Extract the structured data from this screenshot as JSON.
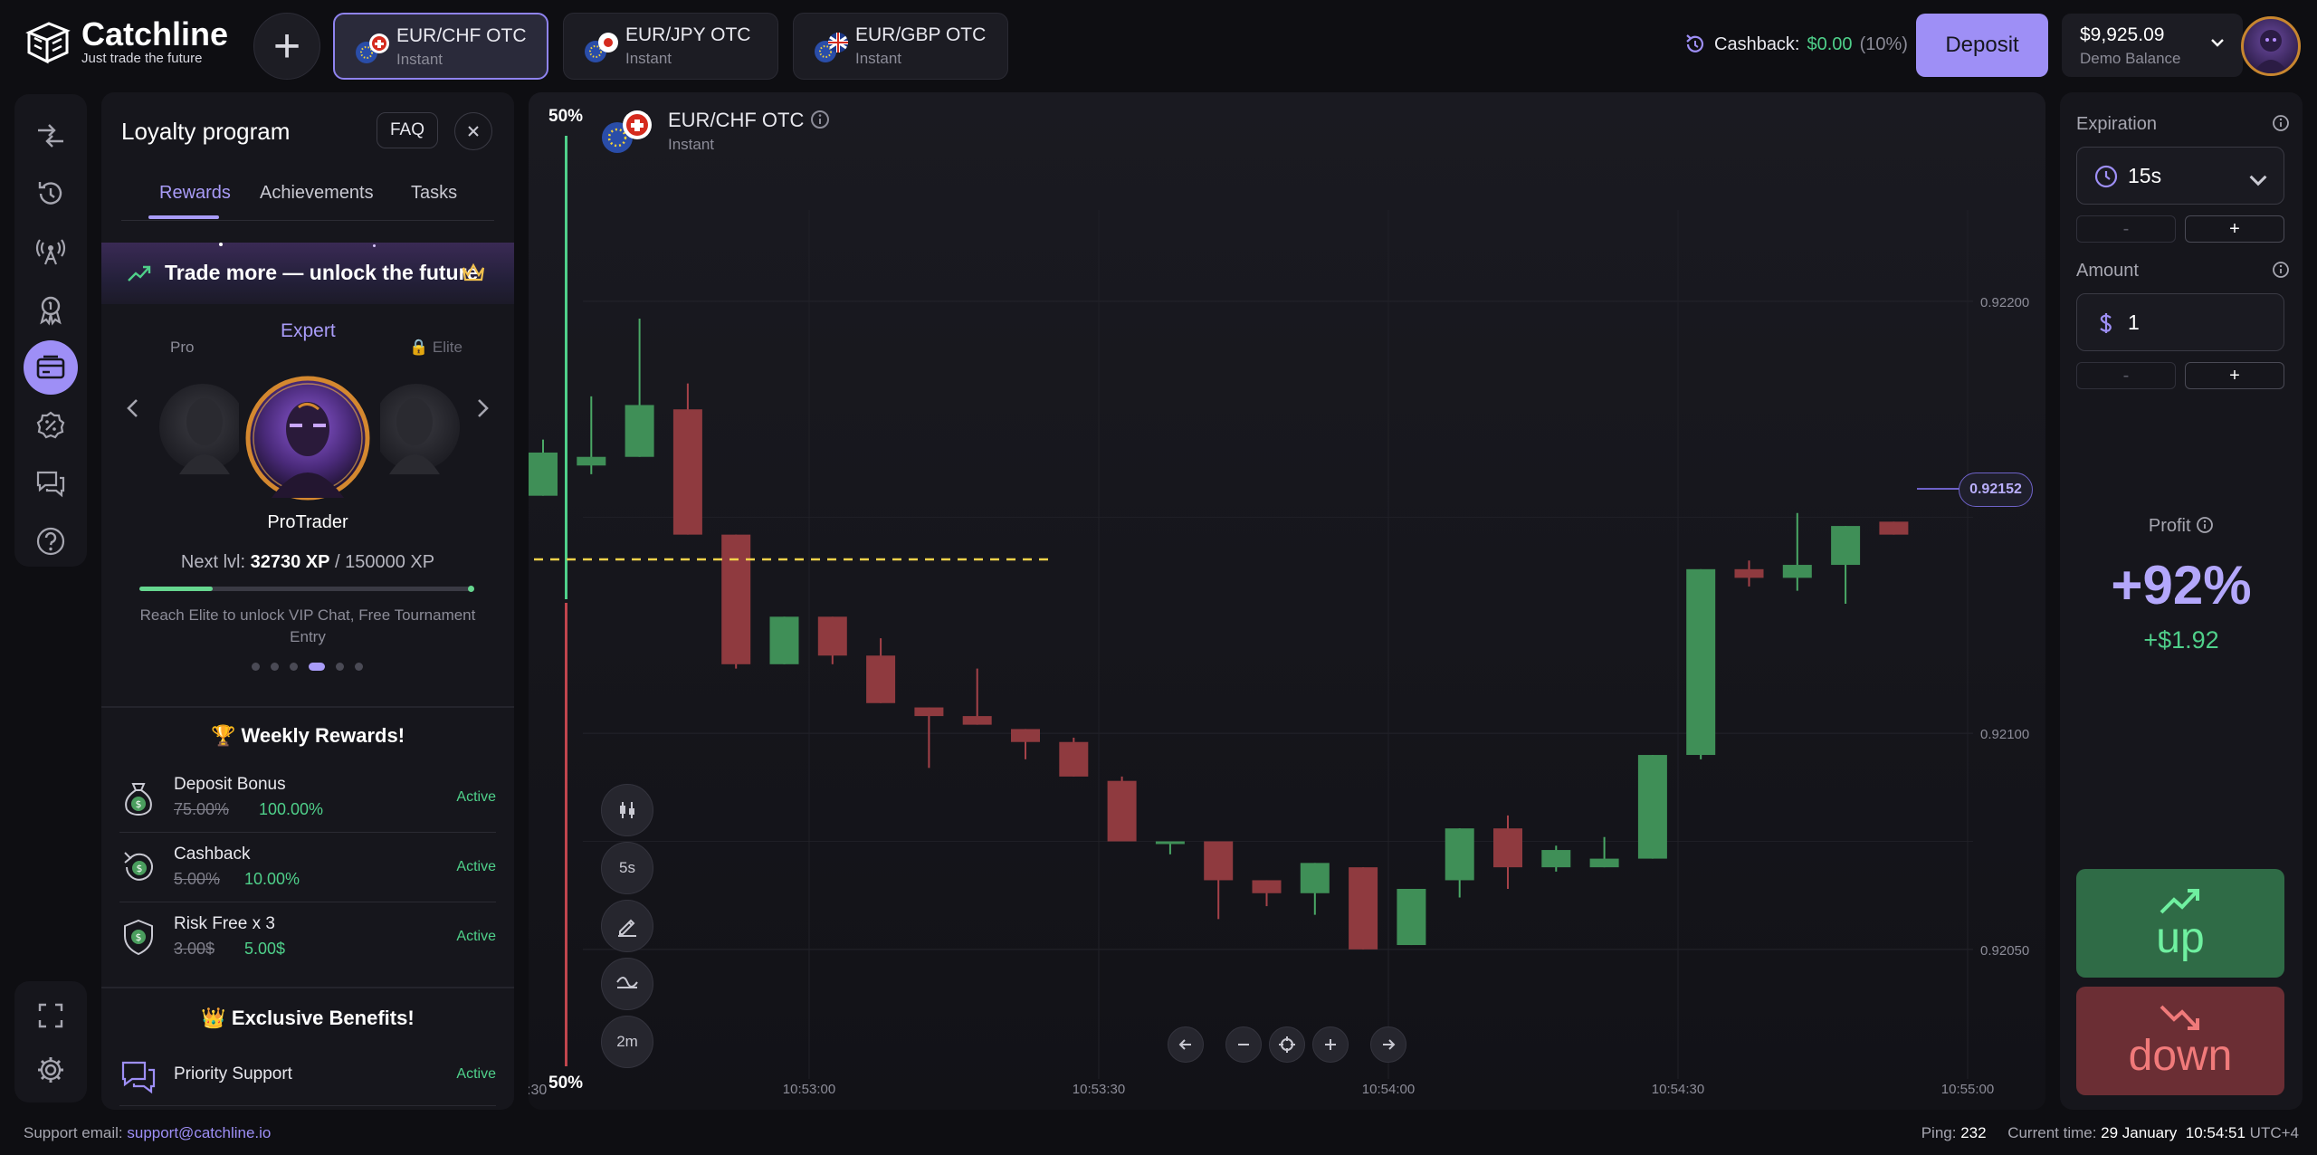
{
  "brand": {
    "name": "Catchline",
    "tagline": "Just trade the future"
  },
  "tabs": [
    {
      "pair": "EUR/CHF OTC",
      "type": "Instant",
      "active": true
    },
    {
      "pair": "EUR/JPY OTC",
      "type": "Instant",
      "active": false
    },
    {
      "pair": "EUR/GBP OTC",
      "type": "Instant",
      "active": false
    }
  ],
  "cashback": {
    "label": "Cashback:",
    "amount": "$0.00",
    "percent": "(10%)"
  },
  "deposit_label": "Deposit",
  "balance": {
    "value": "$9,925.09",
    "label": "Demo Balance"
  },
  "loyalty": {
    "title": "Loyalty program",
    "faq": "FAQ",
    "tabs": [
      "Rewards",
      "Achievements",
      "Tasks"
    ],
    "banner": "Trade more — unlock the future",
    "tiers": {
      "prev": "Pro",
      "current": "Expert",
      "next": "Elite"
    },
    "character": "ProTrader",
    "next_lvl": {
      "label": "Next lvl:",
      "current": "32730 XP",
      "sep": "/",
      "target": "150000 XP",
      "progress": 0.2182
    },
    "reach": "Reach Elite to unlock VIP Chat, Free Tournament Entry",
    "weekly_title": "Weekly Rewards!",
    "weekly": [
      {
        "name": "Deposit Bonus",
        "old": "75.00%",
        "new": "100.00%",
        "status": "Active",
        "icon": "money-bag-icon"
      },
      {
        "name": "Cashback",
        "old": "5.00%",
        "new": "10.00%",
        "status": "Active",
        "icon": "cashback-icon"
      },
      {
        "name": "Risk Free x 3",
        "old": "3.00$",
        "new": "5.00$",
        "status": "Active",
        "icon": "shield-dollar-icon"
      }
    ],
    "exclusive_title": "Exclusive Benefits!",
    "exclusive": [
      {
        "name": "Priority Support",
        "status": "Active",
        "icon": "chat-icon"
      }
    ]
  },
  "chart": {
    "asset": "EUR/CHF OTC",
    "asset_type": "Instant",
    "pct_top": "50%",
    "pct_bottom": "50%",
    "current_price": "0.92152",
    "tools": [
      "candles-icon",
      "5s",
      "pencil-icon",
      "indicator-icon",
      "2m"
    ],
    "x_edge_label": ":30"
  },
  "chart_data": {
    "type": "candlestick",
    "y_ticks": [
      "0.92200",
      "0.92100",
      "0.92050"
    ],
    "x_ticks": [
      "10:53:00",
      "10:53:30",
      "10:54:00",
      "10:54:30",
      "10:55:00"
    ],
    "candles": [
      {
        "o": 0.92155,
        "c": 0.92165,
        "h": 0.92168,
        "l": 0.92155
      },
      {
        "o": 0.92162,
        "c": 0.92164,
        "h": 0.92178,
        "l": 0.9216
      },
      {
        "o": 0.92164,
        "c": 0.92176,
        "h": 0.92196,
        "l": 0.92164
      },
      {
        "o": 0.92175,
        "c": 0.92146,
        "h": 0.92181,
        "l": 0.92146
      },
      {
        "o": 0.92146,
        "c": 0.92116,
        "h": 0.92146,
        "l": 0.92115
      },
      {
        "o": 0.92116,
        "c": 0.92127,
        "h": 0.92127,
        "l": 0.92116
      },
      {
        "o": 0.92127,
        "c": 0.92118,
        "h": 0.92127,
        "l": 0.92116
      },
      {
        "o": 0.92118,
        "c": 0.92107,
        "h": 0.92122,
        "l": 0.92107
      },
      {
        "o": 0.92106,
        "c": 0.92104,
        "h": 0.92106,
        "l": 0.92092
      },
      {
        "o": 0.92104,
        "c": 0.92102,
        "h": 0.92115,
        "l": 0.92102
      },
      {
        "o": 0.92101,
        "c": 0.92098,
        "h": 0.92101,
        "l": 0.92094
      },
      {
        "o": 0.92098,
        "c": 0.9209,
        "h": 0.92099,
        "l": 0.9209
      },
      {
        "o": 0.92089,
        "c": 0.92075,
        "h": 0.9209,
        "l": 0.92075
      },
      {
        "o": 0.92075,
        "c": 0.92075,
        "h": 0.92075,
        "l": 0.92072
      },
      {
        "o": 0.92075,
        "c": 0.92066,
        "h": 0.92075,
        "l": 0.92057
      },
      {
        "o": 0.92066,
        "c": 0.92063,
        "h": 0.92066,
        "l": 0.9206
      },
      {
        "o": 0.92063,
        "c": 0.9207,
        "h": 0.9207,
        "l": 0.92058
      },
      {
        "o": 0.92069,
        "c": 0.9205,
        "h": 0.92069,
        "l": 0.9205
      },
      {
        "o": 0.92051,
        "c": 0.92064,
        "h": 0.92064,
        "l": 0.92051
      },
      {
        "o": 0.92066,
        "c": 0.92078,
        "h": 0.92078,
        "l": 0.92062
      },
      {
        "o": 0.92078,
        "c": 0.92069,
        "h": 0.92081,
        "l": 0.92064
      },
      {
        "o": 0.92069,
        "c": 0.92073,
        "h": 0.92074,
        "l": 0.92068
      },
      {
        "o": 0.92069,
        "c": 0.92071,
        "h": 0.92076,
        "l": 0.92069
      },
      {
        "o": 0.92071,
        "c": 0.92095,
        "h": 0.92095,
        "l": 0.92071
      },
      {
        "o": 0.92095,
        "c": 0.92138,
        "h": 0.92138,
        "l": 0.92094
      },
      {
        "o": 0.92138,
        "c": 0.92136,
        "h": 0.9214,
        "l": 0.92134
      },
      {
        "o": 0.92136,
        "c": 0.92139,
        "h": 0.92151,
        "l": 0.92133
      },
      {
        "o": 0.92139,
        "c": 0.92148,
        "h": 0.92148,
        "l": 0.9213
      },
      {
        "o": 0.92149,
        "c": 0.92146,
        "h": 0.92149,
        "l": 0.92146
      }
    ],
    "ylim": [
      0.9202,
      0.9224
    ],
    "y_tick_values": [
      0.922,
      0.921,
      0.9205
    ],
    "grid": true
  },
  "trade": {
    "expiration_label": "Expiration",
    "expiration_value": "15s",
    "amount_label": "Amount",
    "amount_value": "1",
    "minus": "-",
    "plus": "+",
    "profit_label": "Profit",
    "profit_pct": "+92%",
    "profit_amount": "+$1.92",
    "up_label": "up",
    "down_label": "down"
  },
  "footer": {
    "support_label": "Support email:",
    "support_email": "support@catchline.io",
    "ping_label": "Ping:",
    "ping_value": "232",
    "time_label": "Current time:",
    "date": "29 January",
    "time": "10:54:51",
    "tz": "UTC+4"
  },
  "colors": {
    "accent": "#9e8ff6",
    "green": "#4fd08a",
    "red": "#c0454d"
  }
}
